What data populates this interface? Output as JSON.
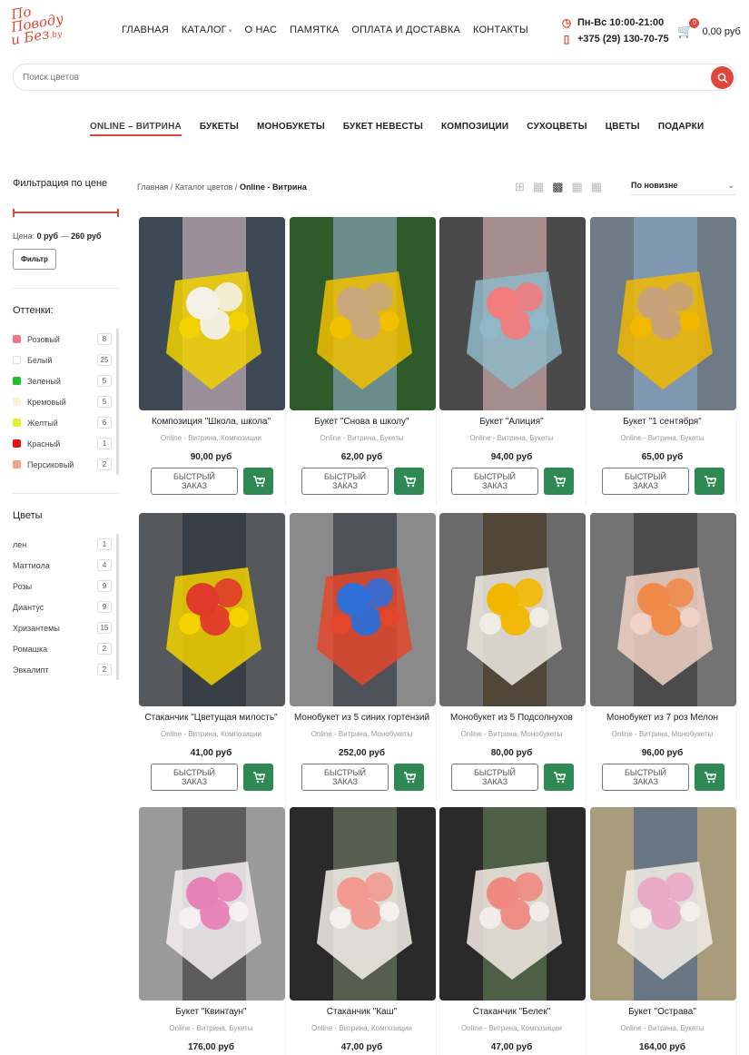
{
  "logo": {
    "line1": "По",
    "line2": "Поводу",
    "line3": "и Без",
    "suffix": ".by"
  },
  "nav": {
    "items": [
      {
        "label": "ГЛАВНАЯ"
      },
      {
        "label": "КАТАЛОГ"
      },
      {
        "label": "О НАС"
      },
      {
        "label": "ПАМЯТКА"
      },
      {
        "label": "ОПЛАТА И ДОСТАВКА"
      },
      {
        "label": "КОНТАКТЫ"
      }
    ]
  },
  "contacts": {
    "hours": "Пн-Вс 10:00-21:00",
    "phone": "+375 (29) 130-70-75"
  },
  "cart": {
    "count": "0",
    "total": "0,00 руб"
  },
  "search": {
    "placeholder": "Поиск цветов"
  },
  "categories": [
    {
      "label": "ONLINE – ВИТРИНА"
    },
    {
      "label": "БУКЕТЫ"
    },
    {
      "label": "МОНОБУКЕТЫ"
    },
    {
      "label": "БУКЕТ НЕВЕСТЫ"
    },
    {
      "label": "КОМПОЗИЦИИ"
    },
    {
      "label": "СУХОЦВЕТЫ"
    },
    {
      "label": "ЦВЕТЫ"
    },
    {
      "label": "ПОДАРКИ"
    }
  ],
  "price_filter": {
    "title": "Фильтрация по цене",
    "label": "Цена:",
    "from": "0 руб",
    "sep": "—",
    "to": "260 руб",
    "button": "Фильтр"
  },
  "shades": {
    "title": "Оттенки:",
    "items": [
      {
        "name": "Розовый",
        "count": "8",
        "color": "#f07a8c"
      },
      {
        "name": "Белый",
        "count": "25",
        "color": "#ffffff"
      },
      {
        "name": "Зеленый",
        "count": "5",
        "color": "#1fbf2a"
      },
      {
        "name": "Кремовый",
        "count": "5",
        "color": "#faf0dc"
      },
      {
        "name": "Желтый",
        "count": "6",
        "color": "#e8ee30"
      },
      {
        "name": "Красный",
        "count": "1",
        "color": "#e01414"
      },
      {
        "name": "Персиковый",
        "count": "2",
        "color": "#f2a585"
      }
    ]
  },
  "flowers": {
    "title": "Цветы",
    "items": [
      {
        "name": "лен",
        "count": "1"
      },
      {
        "name": "Маттиола",
        "count": "4"
      },
      {
        "name": "Розы",
        "count": "9"
      },
      {
        "name": "Диантус",
        "count": "9"
      },
      {
        "name": "Хризантемы",
        "count": "15"
      },
      {
        "name": "Ромашка",
        "count": "2"
      },
      {
        "name": "Эвкалипт",
        "count": "2"
      }
    ]
  },
  "breadcrumb": {
    "home": "Главная",
    "sep": "/",
    "catalog": "Каталог цветов",
    "current": "Online - Витрина"
  },
  "sort": {
    "selected": "По новизне"
  },
  "quick_order_label": "БЫСТРЫЙ ЗАКАЗ",
  "products": [
    {
      "title": "Композиция \"Школа, школа\"",
      "cats": "Online - Витрина, Композиции",
      "price": "90,00 руб",
      "palette": [
        "#3d4a55",
        "#f3f0e8",
        "#f2d200",
        "#e9cbd4"
      ]
    },
    {
      "title": "Букет \"Снова в школу\"",
      "cats": "Online - Витрина, Букеты",
      "price": "62,00 руб",
      "palette": [
        "#2f5a2a",
        "#c9a77d",
        "#f2c000",
        "#9ab6d8"
      ]
    },
    {
      "title": "Букет \"Алиция\"",
      "cats": "Online - Витрина, Букеты",
      "price": "94,00 руб",
      "palette": [
        "#4a4a4a",
        "#f07c7c",
        "#8fb8c8",
        "#f4c6c6"
      ]
    },
    {
      "title": "Букет \"1 сентября\"",
      "cats": "Online - Витрина, Букеты",
      "price": "65,00 руб",
      "palette": [
        "#6e7b86",
        "#c7a27a",
        "#f2b800",
        "#8fb0d6"
      ]
    },
    {
      "title": "Стаканчик \"Цветущая милость\"",
      "cats": "Online - Витрина, Композиции",
      "price": "41,00 руб",
      "palette": [
        "#55595c",
        "#e03a2a",
        "#f5d200",
        "#222a35"
      ]
    },
    {
      "title": "Монобукет из 5 синих гортензий",
      "cats": "Online - Витрина, Монобукеты",
      "price": "252,00 руб",
      "palette": [
        "#8a8a8a",
        "#2e6fd8",
        "#e3462a",
        "#1b2430"
      ]
    },
    {
      "title": "Монобукет из 5 Подсолнухов",
      "cats": "Online - Витрина, Монобукеты",
      "price": "80,00 руб",
      "palette": [
        "#6a6a6a",
        "#f2b800",
        "#f0ece4",
        "#3a2a10"
      ]
    },
    {
      "title": "Монобукет из 7 роз Мелон",
      "cats": "Online - Витрина, Монобукеты",
      "price": "96,00 руб",
      "palette": [
        "#737373",
        "#f08a4a",
        "#f2d2c6",
        "#2a2a2a"
      ]
    },
    {
      "title": "Букет \"Квинтаун\"",
      "cats": "Online - Витрина, Букеты",
      "price": "176,00 руб",
      "palette": [
        "#9a9a9a",
        "#e782b6",
        "#f6f0f2",
        "#2a2a2a"
      ]
    },
    {
      "title": "Стаканчик \"Каш\"",
      "cats": "Online - Витрина, Композиции",
      "price": "47,00 руб",
      "palette": [
        "#2a2a2a",
        "#f29a90",
        "#f4f1ec",
        "#7a8a6a"
      ]
    },
    {
      "title": "Стаканчик \"Белек\"",
      "cats": "Online - Витрина, Композиции",
      "price": "47,00 руб",
      "palette": [
        "#2a2a2a",
        "#f08a80",
        "#f4ece8",
        "#6a8a5a"
      ]
    },
    {
      "title": "Букет \"Острава\"",
      "cats": "Online - Витрина, Букеты",
      "price": "164,00 руб",
      "palette": [
        "#a89c7c",
        "#e9a8c4",
        "#f3efe8",
        "#355a8a"
      ]
    }
  ]
}
